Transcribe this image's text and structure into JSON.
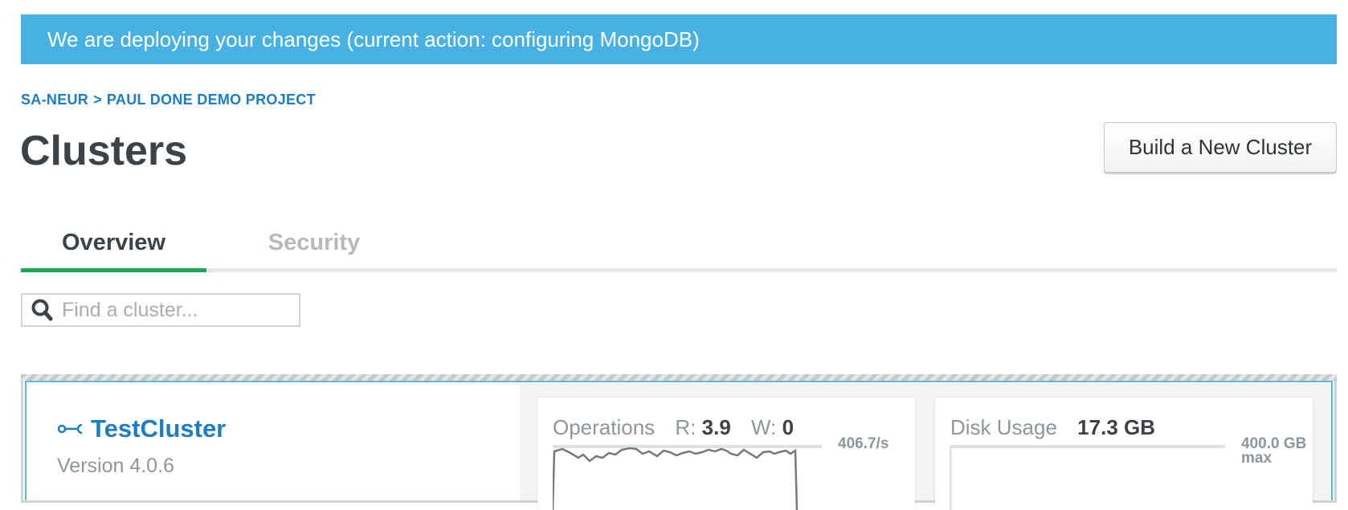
{
  "banner": {
    "message": "We are deploying your changes (current action: configuring MongoDB)"
  },
  "breadcrumb": {
    "org": "SA-NEUR",
    "separator": ">",
    "project": "PAUL DONE DEMO PROJECT"
  },
  "page": {
    "title": "Clusters",
    "build_button_label": "Build a New Cluster"
  },
  "tabs": [
    {
      "label": "Overview",
      "active": true
    },
    {
      "label": "Security",
      "active": false
    }
  ],
  "search": {
    "placeholder": "Find a cluster...",
    "value": ""
  },
  "cluster": {
    "name": "TestCluster",
    "version": "Version 4.0.6",
    "operations": {
      "title": "Operations",
      "read_label": "R:",
      "read_value": "3.9",
      "write_label": "W:",
      "write_value": "0",
      "max_label": "406.7/s"
    },
    "disk_usage": {
      "title": "Disk Usage",
      "value": "17.3 GB",
      "max_value": "400.0 GB",
      "max_label": "max"
    }
  },
  "colors": {
    "banner": "#47b1e4",
    "link": "#1c7cc4",
    "active_tab_underline": "#13aa52",
    "card_border": "#5cb8e6"
  },
  "icons": {
    "search": "search-icon",
    "cluster": "key-icon"
  }
}
